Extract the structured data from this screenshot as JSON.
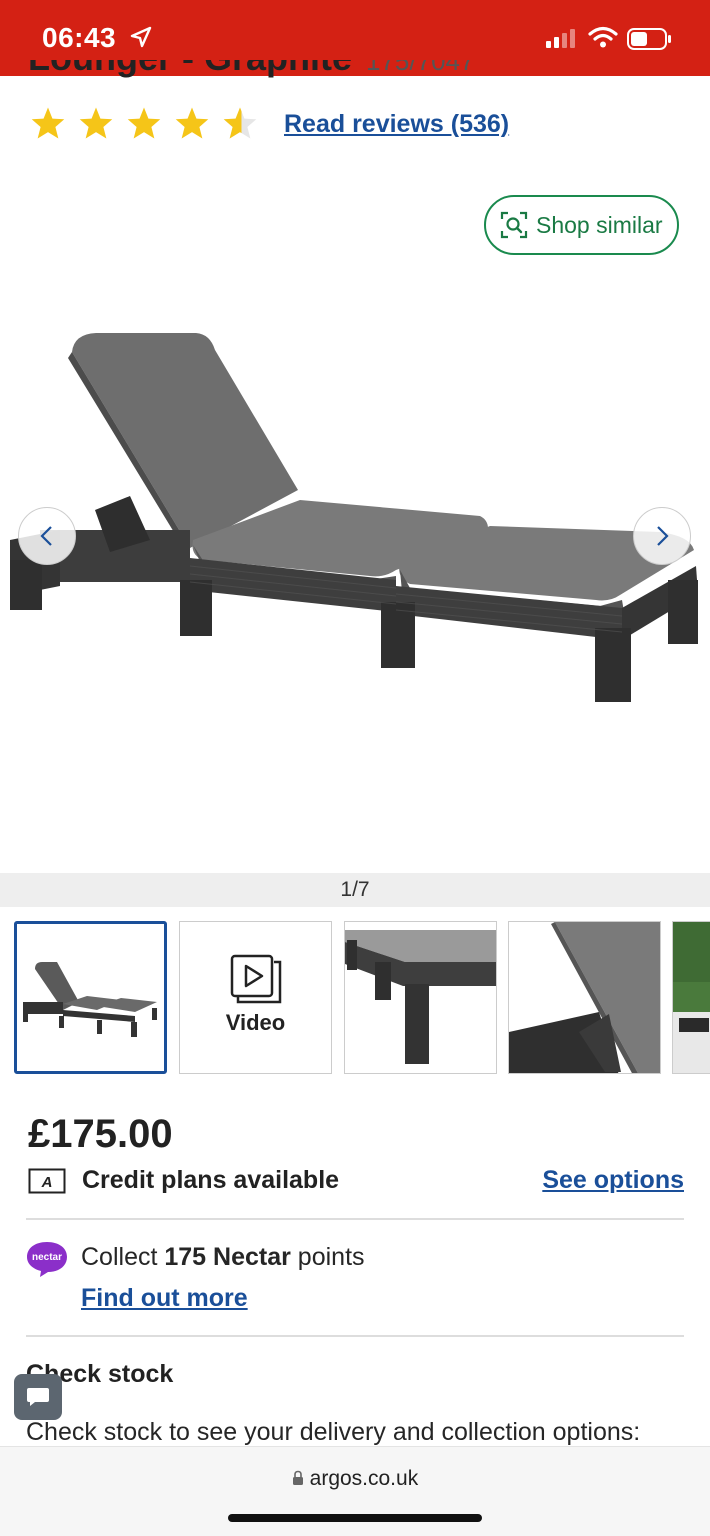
{
  "status_bar": {
    "time": "06:43"
  },
  "product": {
    "title": "Lounger - Graphite",
    "sku": "175/7047",
    "rating_stars": 4.5,
    "reviews_link": "Read reviews (536)",
    "shop_similar": "Shop similar",
    "image_counter": "1/7",
    "thumb_video_label": "Video",
    "price": "£175.00",
    "credit_icon_letter": "A",
    "credit_text": "Credit plans available",
    "see_options": "See options"
  },
  "nectar": {
    "logo_text": "nectar",
    "collect_prefix": "Collect ",
    "points_bold": "175 Nectar",
    "collect_suffix": " points",
    "find_out_more": "Find out more"
  },
  "stock": {
    "title": "Check stock",
    "description": "Check stock to see your delivery and collection options:"
  },
  "browser": {
    "url": "argos.co.uk"
  },
  "colors": {
    "brand_red": "#d42114",
    "link_blue": "#1a4f99",
    "star_yellow": "#f5c518",
    "shop_similar_green": "#1a8a4e",
    "nectar_purple": "#8b2fc9"
  }
}
